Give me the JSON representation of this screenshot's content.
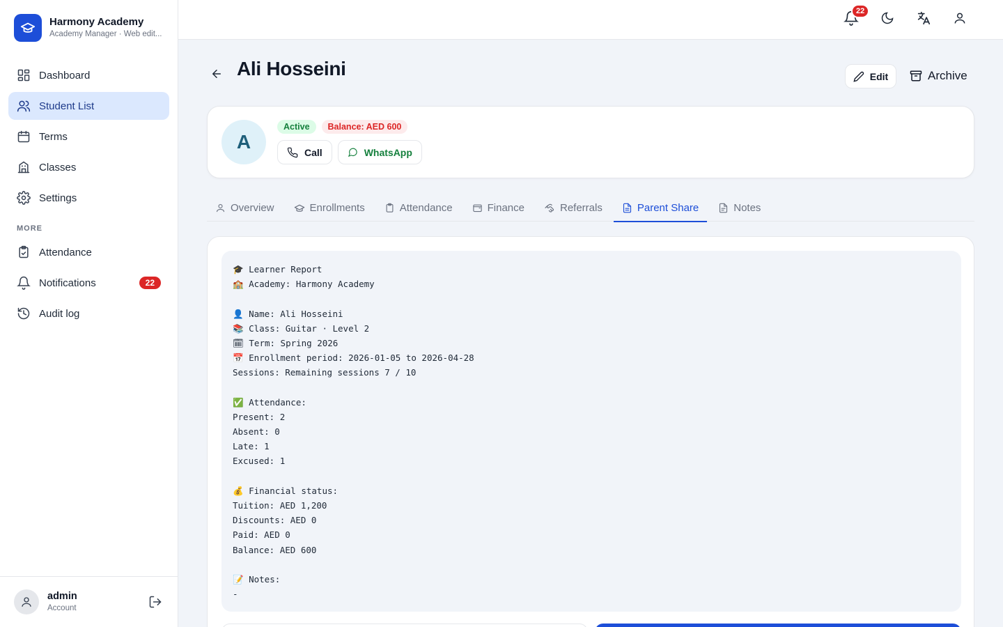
{
  "brand": {
    "name": "Harmony Academy",
    "subtitle": "Academy Manager · Web edit..."
  },
  "sidebar": {
    "items": [
      {
        "label": "Dashboard",
        "icon": "dashboard-icon"
      },
      {
        "label": "Student List",
        "icon": "users-icon",
        "active": true
      },
      {
        "label": "Terms",
        "icon": "calendar-icon"
      },
      {
        "label": "Classes",
        "icon": "building-icon"
      },
      {
        "label": "Settings",
        "icon": "gear-icon"
      }
    ],
    "more_heading": "MORE",
    "more_items": [
      {
        "label": "Attendance",
        "icon": "clipboard-icon"
      },
      {
        "label": "Notifications",
        "icon": "bell-icon",
        "badge": "22"
      },
      {
        "label": "Audit log",
        "icon": "history-icon"
      }
    ]
  },
  "user": {
    "name": "admin",
    "role": "Account"
  },
  "topbar": {
    "notification_count": "22"
  },
  "page": {
    "title": "Ali Hosseini",
    "edit_label": "Edit",
    "archive_label": "Archive"
  },
  "profile": {
    "initial": "A",
    "status": "Active",
    "balance": "Balance: AED 600",
    "call_label": "Call",
    "whatsapp_label": "WhatsApp"
  },
  "tabs": [
    {
      "label": "Overview",
      "icon": "user-icon"
    },
    {
      "label": "Enrollments",
      "icon": "graduation-cap-icon"
    },
    {
      "label": "Attendance",
      "icon": "clipboard-icon"
    },
    {
      "label": "Finance",
      "icon": "wallet-icon"
    },
    {
      "label": "Referrals",
      "icon": "handshake-icon"
    },
    {
      "label": "Parent Share",
      "icon": "file-text-icon",
      "active": true
    },
    {
      "label": "Notes",
      "icon": "notes-icon"
    }
  ],
  "report": {
    "lines": [
      "🎓 Learner Report",
      "🏫 Academy: Harmony Academy",
      "",
      "👤 Name: Ali Hosseini",
      "📚 Class: Guitar · Level 2",
      "🗓 Term: Spring 2026",
      "📅 Enrollment period: 2026-01-05 to 2026-04-28",
      "Sessions: Remaining sessions 7 / 10",
      "",
      "✅ Attendance:",
      "Present: 2",
      "Absent: 0",
      "Late: 1",
      "Excused: 1",
      "",
      "💰 Financial status:",
      "Tuition: AED 1,200",
      "Discounts: AED 0",
      "Paid: AED 0",
      "Balance: AED 600",
      "",
      "📝 Notes:",
      "-"
    ]
  },
  "colors": {
    "accent": "#1d4ed8",
    "danger": "#dc2626",
    "success": "#15803d"
  }
}
